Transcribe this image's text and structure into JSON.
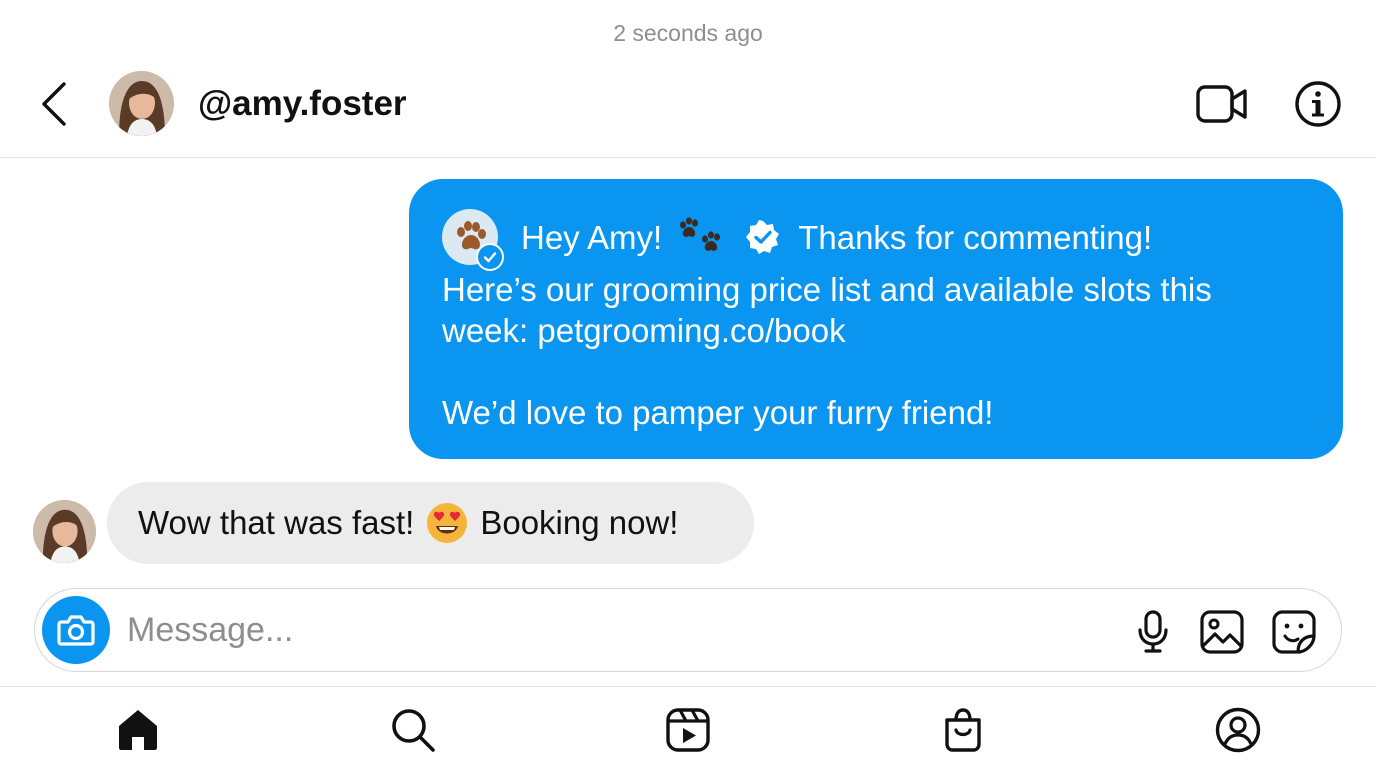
{
  "timestamp": "2 seconds ago",
  "header": {
    "username": "@amy.foster",
    "icons": [
      "back-chevron-icon",
      "video-call-icon",
      "info-icon"
    ]
  },
  "messages": {
    "sent": {
      "greeting": "Hey Amy!",
      "thanks": "Thanks for commenting!",
      "line2": "Here’s our grooming price list and available slots this",
      "line3": "week: petgrooming.co/book",
      "line4": "We’d love to pamper your furry friend!"
    },
    "received": {
      "text_before": "Wow that was fast!",
      "text_after": "Booking now!"
    }
  },
  "composer": {
    "placeholder": "Message...",
    "icons": [
      "camera-icon",
      "microphone-icon",
      "gallery-icon",
      "sticker-icon"
    ]
  },
  "bottom_nav": {
    "items": [
      "home-icon",
      "search-icon",
      "reels-icon",
      "shop-icon",
      "profile-icon"
    ]
  },
  "colors": {
    "accent": "#0a95f0",
    "received_bubble": "#ececec",
    "muted_text": "#8e8e8e"
  }
}
